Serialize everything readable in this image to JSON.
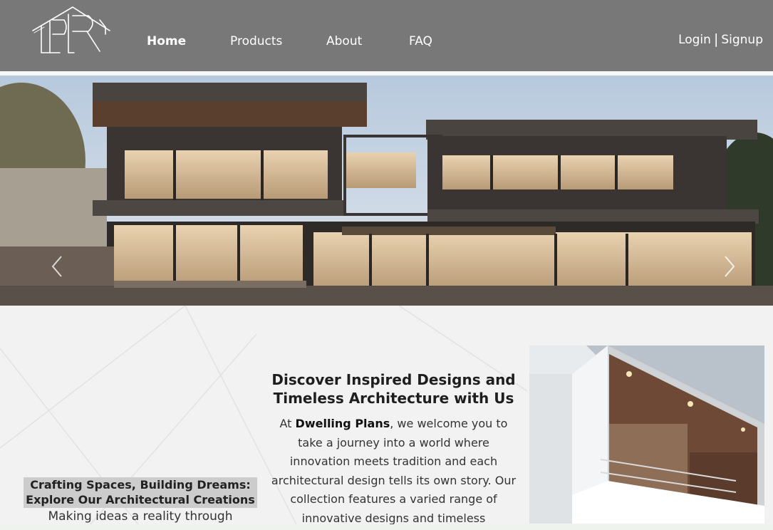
{
  "header": {
    "logo": {
      "icon": "house-logo-icon"
    },
    "nav": [
      {
        "label": "Home",
        "active": true
      },
      {
        "label": "Products",
        "active": false
      },
      {
        "label": "About",
        "active": false
      },
      {
        "label": "FAQ",
        "active": false
      }
    ],
    "auth": {
      "login": "Login",
      "separator": "|",
      "signup": "Signup"
    }
  },
  "hero": {
    "prev_icon": "chevron-left-icon",
    "next_icon": "chevron-right-icon"
  },
  "tagline": {
    "line1": "Crafting Spaces, Building Dreams:",
    "line2": "Explore Our Architectural Creations",
    "sub": "Making ideas a reality through"
  },
  "intro": {
    "heading_line1": "Discover Inspired Designs and",
    "heading_line2": "Timeless Architecture with Us",
    "text_before": "At ",
    "brand": "Dwelling Plans",
    "text_after": ", we welcome you to take a journey into a world where innovation meets tradition and each architectural design tells its own story. Our collection features a varied range of innovative designs and timeless"
  },
  "colors": {
    "header_bg": "#787878",
    "page_bg": "#f2f2f2",
    "tagline_bg": "#cccccc"
  }
}
